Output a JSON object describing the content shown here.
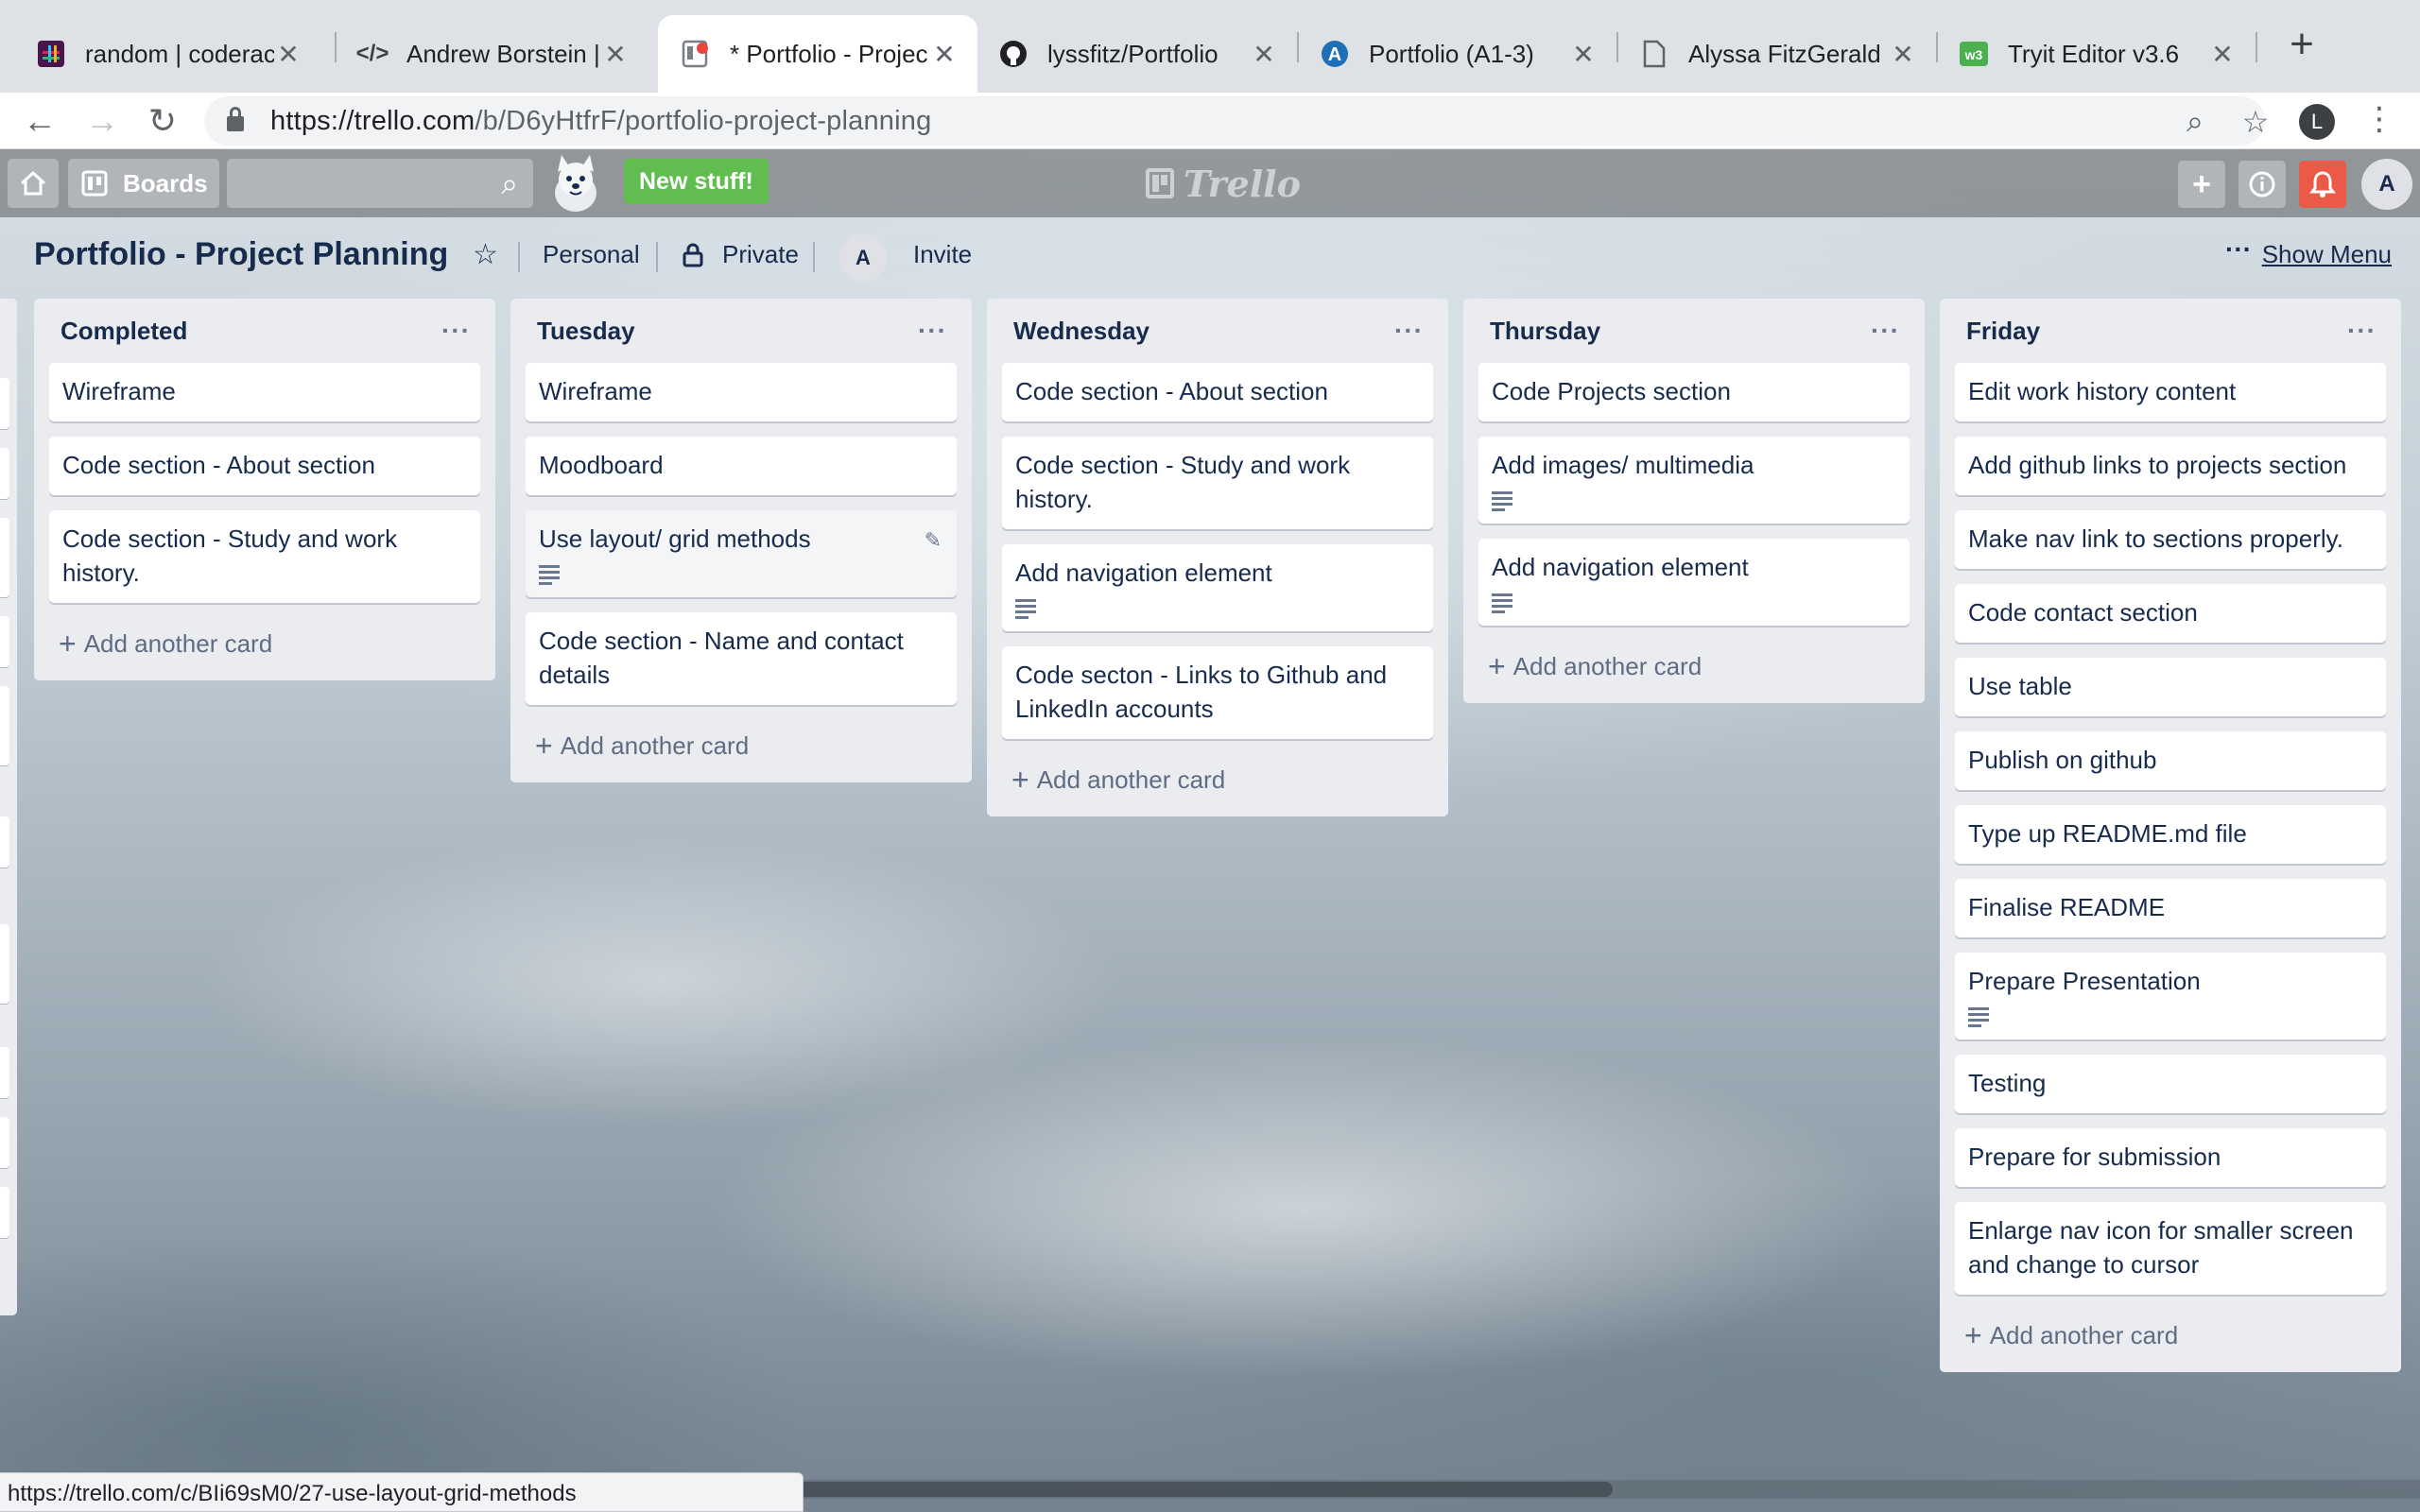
{
  "browser": {
    "tabs": [
      {
        "title": "random | coderaca",
        "icon": "slack-icon",
        "active": false
      },
      {
        "title": "Andrew Borstein |",
        "icon": "code-icon",
        "active": false
      },
      {
        "title": "* Portfolio - Projec",
        "icon": "trello-favicon-icon",
        "active": true
      },
      {
        "title": "lyssfitz/Portfolio",
        "icon": "github-icon",
        "active": false
      },
      {
        "title": "Portfolio (A1-3)",
        "icon": "canvas-icon",
        "active": false
      },
      {
        "title": "Alyssa FitzGerald |",
        "icon": "document-icon",
        "active": false
      },
      {
        "title": "Tryit Editor v3.6",
        "icon": "w3schools-icon",
        "active": false
      }
    ],
    "url_host": "https://trello.com",
    "url_path": "/b/D6yHtfrF/portfolio-project-planning",
    "profile_initial": "L",
    "status_url": "https://trello.com/c/BIi69sM0/27-use-layout-grid-methods"
  },
  "trello_header": {
    "boards_label": "Boards",
    "new_stuff_label": "New stuff!",
    "logo_text": "Trello",
    "avatar_initial": "A"
  },
  "board": {
    "title": "Portfolio - Project Planning",
    "team_label": "Personal",
    "visibility_label": "Private",
    "member_initial": "A",
    "invite_label": "Invite",
    "show_menu_label": "Show Menu"
  },
  "lists": [
    {
      "title": "Completed",
      "cards": [
        {
          "text": "Wireframe"
        },
        {
          "text": "Code section - About section"
        },
        {
          "text": "Code section - Study and work history."
        }
      ],
      "add_label": "Add another card"
    },
    {
      "title": "Tuesday",
      "cards": [
        {
          "text": "Wireframe"
        },
        {
          "text": "Moodboard"
        },
        {
          "text": "Use layout/ grid methods",
          "has_description": true,
          "hovered": true
        },
        {
          "text": "Code section - Name and contact details"
        }
      ],
      "add_label": "Add another card"
    },
    {
      "title": "Wednesday",
      "cards": [
        {
          "text": "Code section - About section"
        },
        {
          "text": "Code section - Study and work history."
        },
        {
          "text": "Add navigation element",
          "has_description": true
        },
        {
          "text": "Code secton - Links to Github and LinkedIn accounts"
        }
      ],
      "add_label": "Add another card"
    },
    {
      "title": "Thursday",
      "cards": [
        {
          "text": "Code Projects section"
        },
        {
          "text": "Add images/ multimedia",
          "has_description": true
        },
        {
          "text": "Add navigation element",
          "has_description": true
        }
      ],
      "add_label": "Add another card"
    },
    {
      "title": "Friday",
      "cards": [
        {
          "text": "Edit work history content"
        },
        {
          "text": "Add github links to projects section"
        },
        {
          "text": "Make nav link to sections properly."
        },
        {
          "text": "Code contact section"
        },
        {
          "text": "Use table"
        },
        {
          "text": "Publish on github"
        },
        {
          "text": "Type up README.md file"
        },
        {
          "text": "Finalise README"
        },
        {
          "text": "Prepare Presentation",
          "has_description": true
        },
        {
          "text": "Testing"
        },
        {
          "text": "Prepare for submission"
        },
        {
          "text": "Enlarge nav icon for smaller screen and change to cursor"
        }
      ],
      "add_label": "Add another card"
    }
  ],
  "colors": {
    "new_stuff_green": "#61bd4f",
    "notification_red": "#eb5a46",
    "list_bg": "#ebecf0",
    "card_text": "#172b4d"
  }
}
